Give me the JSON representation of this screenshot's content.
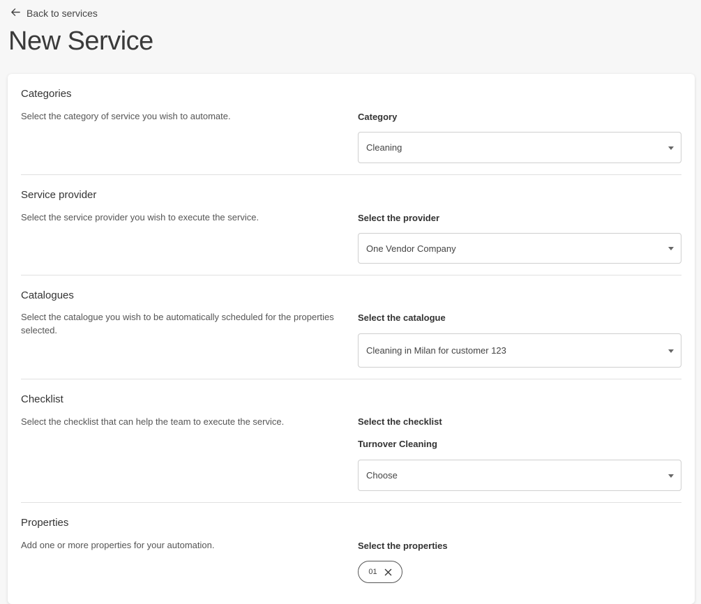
{
  "header": {
    "back_label": "Back to services",
    "title": "New Service"
  },
  "sections": {
    "categories": {
      "title": "Categories",
      "description": "Select the category of service you wish to automate.",
      "field_label": "Category",
      "value": "Cleaning"
    },
    "provider": {
      "title": "Service provider",
      "description": "Select the service provider you wish to execute the service.",
      "field_label": "Select the provider",
      "value": "One Vendor Company"
    },
    "catalogues": {
      "title": "Catalogues",
      "description": "Select the catalogue you wish to be automatically scheduled for the properties selected.",
      "field_label": "Select the catalogue",
      "value": "Cleaning in Milan for customer 123"
    },
    "checklist": {
      "title": "Checklist",
      "description": "Select the checklist that can help the team to execute the service.",
      "field_label": "Select the checklist",
      "sub_label": "Turnover Cleaning",
      "value": "Choose"
    },
    "properties": {
      "title": "Properties",
      "description": "Add one or more properties for your automation.",
      "field_label": "Select the properties",
      "chips": [
        "01"
      ]
    }
  },
  "icons": {
    "back": "arrow-left-icon",
    "dropdown": "caret-down-icon",
    "remove": "close-icon"
  }
}
